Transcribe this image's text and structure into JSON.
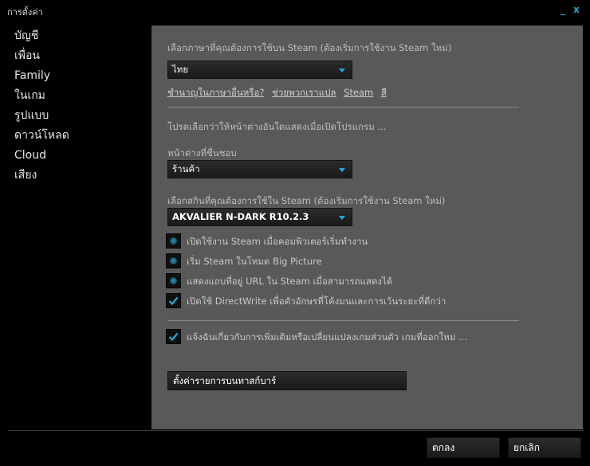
{
  "window": {
    "title": "การตั้งค่า",
    "minimize_label": "_",
    "close_label": "x"
  },
  "sidebar": {
    "items": [
      {
        "label": "บัญชี"
      },
      {
        "label": "เพื่อน"
      },
      {
        "label": "Family"
      },
      {
        "label": "ในเกม"
      },
      {
        "label": "รูปแบบ"
      },
      {
        "label": "ดาวน์โหลด"
      },
      {
        "label": "Cloud"
      },
      {
        "label": "เสียง"
      }
    ]
  },
  "interface": {
    "language_label": "เลือกภาษาที่คุณต้องการใช้บน Steam (ต้องเริ่มการใช้งาน Steam ใหม่)",
    "language_value": "ไทย",
    "links": [
      "ชำนาญในภาษาอื่นหรือ?",
      "ช่วยพวกเราแปล",
      "Steam",
      "สี"
    ],
    "startup_desc": "โปรดเลือกว่าให้หน้าต่างอันใดแสดงเมื่อเปิดโปรแกรม ...",
    "favorite_window_label": "หน้าต่างที่ชื่นชอบ",
    "favorite_window_value": "ร้านค้า",
    "skin_label": "เลือกสกินที่คุณต้องการใช้ใน Steam (ต้องเริ่มการใช้งาน Steam ใหม่)",
    "skin_value": "AKVALIER N-DARK R10.2.3",
    "checkboxes": [
      {
        "label": "เปิดใช้งาน Steam เมื่อคอมพิวเตอร์เริ่มทำงาน",
        "checked": false
      },
      {
        "label": "เริ่ม Steam ในโหมด Big Picture",
        "checked": false
      },
      {
        "label": "แสดงแถบที่อยู่ URL ใน Steam เมื่อสามารถแสดงได้",
        "checked": false
      },
      {
        "label": "เปิดใช้ DirectWrite เพื่อตัวอักษรที่โค้งมนและการเว้นระยะที่ดีกว่า",
        "checked": true
      }
    ],
    "notify": {
      "label": "แจ้งฉันเกี่ยวกับการเพิ่มเติมหรือเปลี่ยนแปลงเกมส่วนตัว เกมที่ออกใหม่ ...",
      "checked": true
    },
    "taskbar_button": "ตั้งค่ารายการบนทาสก์บาร์"
  },
  "footer": {
    "ok": "ตกลง",
    "cancel": "ยกเลิก"
  },
  "colors": {
    "accent": "#1fa9d8",
    "panel": "#595959",
    "background": "#000000"
  }
}
